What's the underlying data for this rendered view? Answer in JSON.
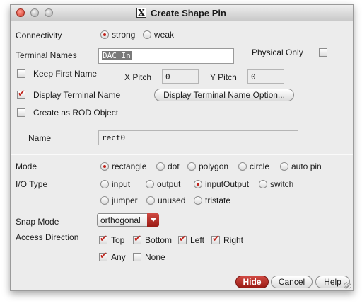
{
  "window": {
    "title": "Create Shape Pin",
    "title_icon": "X"
  },
  "connectivity": {
    "label": "Connectivity",
    "options": [
      "strong",
      "weak"
    ],
    "selected": "strong"
  },
  "terminal_names": {
    "label": "Terminal Names",
    "value": "DAC_In"
  },
  "physical_only": {
    "label": "Physical Only",
    "checked": false
  },
  "keep_first_name": {
    "label": "Keep First Name",
    "checked": false
  },
  "x_pitch": {
    "label": "X Pitch",
    "value": "0"
  },
  "y_pitch": {
    "label": "Y Pitch",
    "value": "0"
  },
  "display_terminal_name": {
    "label": "Display Terminal Name",
    "checked": true
  },
  "display_terminal_name_option": {
    "label": "Display Terminal Name Option..."
  },
  "create_rod_object": {
    "label": "Create as ROD Object",
    "checked": false
  },
  "name": {
    "label": "Name",
    "value": "rect0"
  },
  "mode": {
    "label": "Mode",
    "options": [
      "rectangle",
      "dot",
      "polygon",
      "circle",
      "auto pin"
    ],
    "selected": "rectangle"
  },
  "io_type": {
    "label": "I/O Type",
    "options": [
      "input",
      "output",
      "inputOutput",
      "switch",
      "jumper",
      "unused",
      "tristate"
    ],
    "selected": "inputOutput"
  },
  "snap_mode": {
    "label": "Snap Mode",
    "value": "orthogonal"
  },
  "access_direction": {
    "label": "Access Direction",
    "options": [
      "Top",
      "Bottom",
      "Left",
      "Right",
      "Any",
      "None"
    ],
    "checked": [
      "Top",
      "Bottom",
      "Left",
      "Right",
      "Any"
    ]
  },
  "buttons": {
    "hide": "Hide",
    "cancel": "Cancel",
    "help": "Help"
  },
  "colors": {
    "accent": "#c0231b"
  }
}
